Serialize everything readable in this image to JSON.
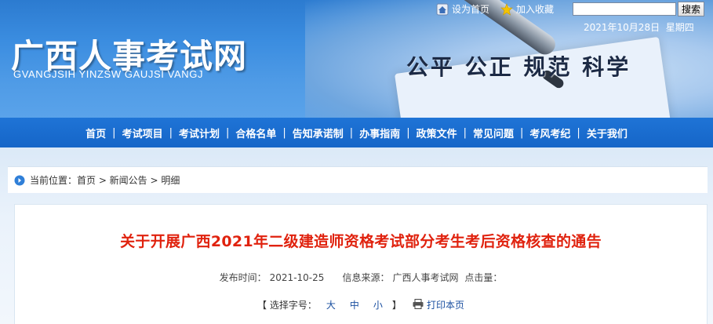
{
  "header": {
    "site_title": "广西人事考试网",
    "site_pinyin": "GVANGJSIH YINZSW GAUJSI VANGJ",
    "slogan": "公平 公正 规范 科学",
    "set_homepage": "设为首页",
    "add_favorite": "加入收藏",
    "search_placeholder": "",
    "search_button": "搜索",
    "date": "2021年10月28日",
    "weekday": "星期四"
  },
  "nav": {
    "items": [
      {
        "label": "首页"
      },
      {
        "label": "考试项目"
      },
      {
        "label": "考试计划"
      },
      {
        "label": "合格名单"
      },
      {
        "label": "告知承诺制"
      },
      {
        "label": "办事指南"
      },
      {
        "label": "政策文件"
      },
      {
        "label": "常见问题"
      },
      {
        "label": "考风考纪"
      },
      {
        "label": "关于我们"
      }
    ],
    "separator": "|"
  },
  "breadcrumb": {
    "text": "当前位置：首页 > 新闻公告 > 明细"
  },
  "article": {
    "title": "关于开展广西2021年二级建造师资格考试部分考生考后资格核查的通告",
    "publish_label": "发布时间：",
    "publish_date": "2021-10-25",
    "source_label": "信息来源：",
    "source": "广西人事考试网",
    "clicks_label": "点击量："
  },
  "font_size": {
    "prefix": "【 选择字号：",
    "large": "大",
    "medium": "中",
    "small": "小",
    "suffix": "】",
    "print": "打印本页"
  },
  "colors": {
    "nav_blue": "#1565c8",
    "title_red": "#e0220e",
    "link_blue": "#1a4fa0"
  }
}
